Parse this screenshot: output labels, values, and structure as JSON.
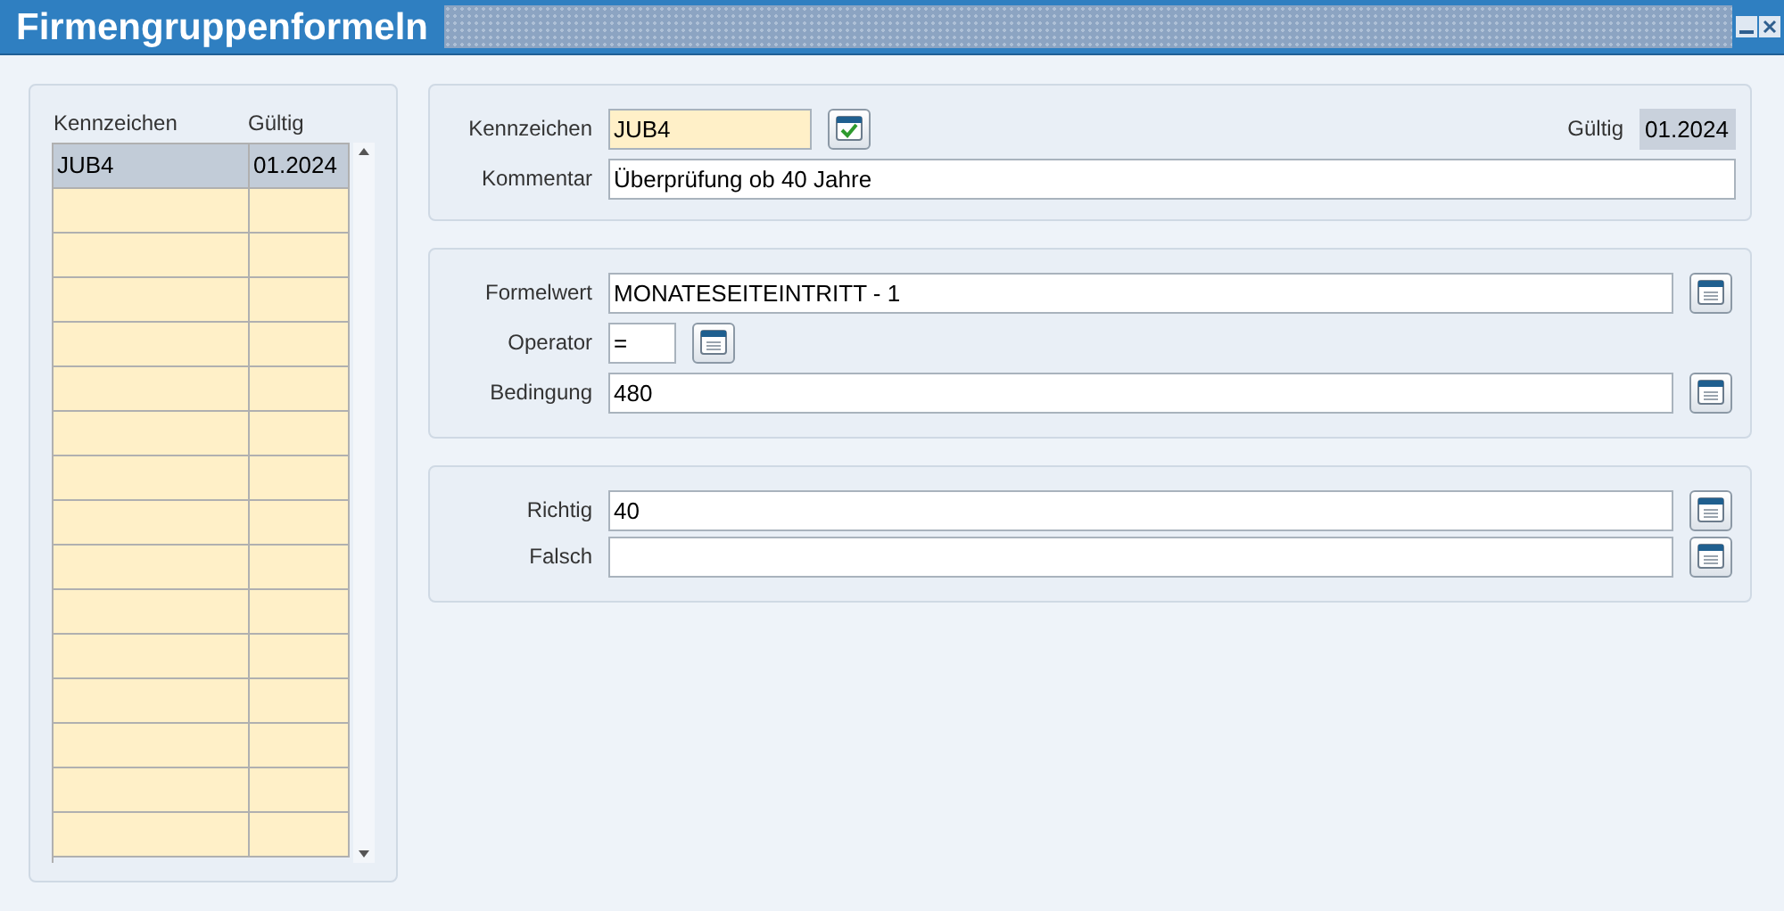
{
  "window": {
    "title": "Firmengruppenformeln"
  },
  "list": {
    "columns": [
      "Kennzeichen",
      "Gültig"
    ],
    "rows": [
      {
        "cells": [
          "JUB4",
          "01.2024"
        ],
        "selected": true
      }
    ]
  },
  "header": {
    "kennzeichen": {
      "label": "Kennzeichen",
      "value": "JUB4"
    },
    "gueltig": {
      "label": "Gültig",
      "value": "01.2024"
    },
    "kommentar": {
      "label": "Kommentar",
      "value": "Überprüfung ob 40 Jahre"
    }
  },
  "formula": [
    {
      "label": "Formelwert",
      "value": "MONATESEITEINTRITT - 1",
      "kind": "wide"
    },
    {
      "label": "Operator",
      "value": "=",
      "kind": "short"
    },
    {
      "label": "Bedingung",
      "value": "480",
      "kind": "wide"
    }
  ],
  "result": [
    {
      "label": "Richtig",
      "value": "40",
      "kind": "wide"
    },
    {
      "label": "Falsch",
      "kind": "wide"
    }
  ]
}
